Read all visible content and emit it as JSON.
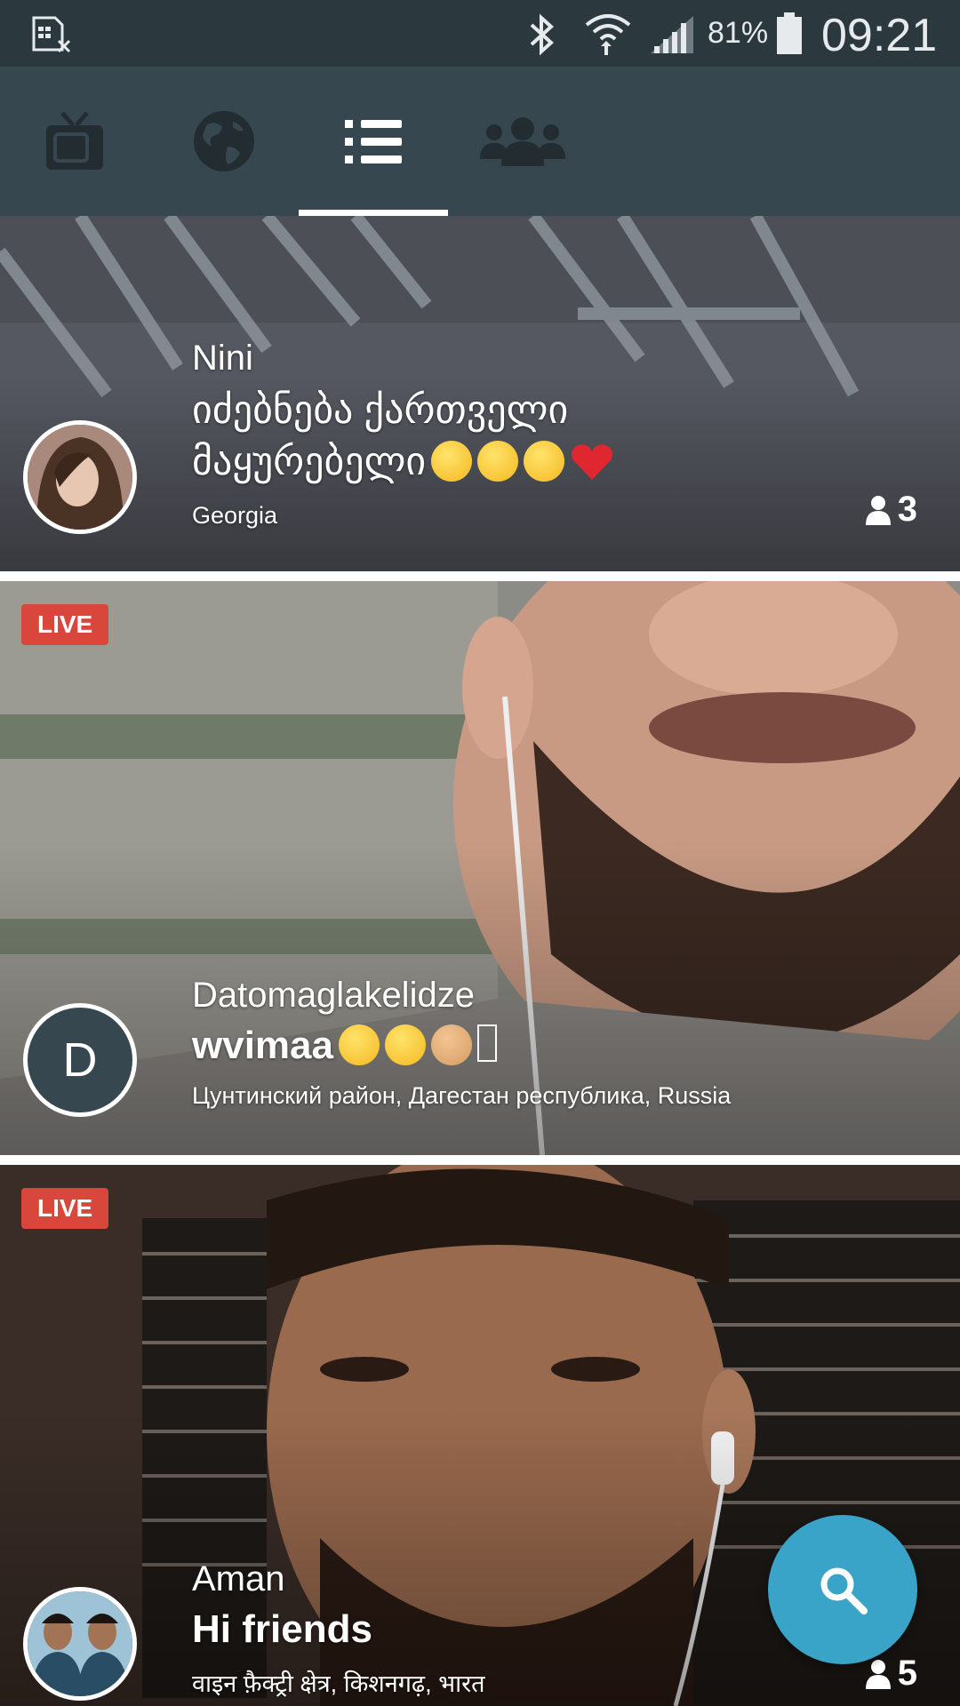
{
  "status_bar": {
    "battery_percent": "81%",
    "time": "09:21",
    "icons": [
      "sim-card-icon",
      "bluetooth-icon",
      "wifi-icon",
      "signal-icon",
      "battery-icon"
    ]
  },
  "tabs": [
    {
      "name": "tv",
      "icon": "tv-icon",
      "active": false
    },
    {
      "name": "globe",
      "icon": "globe-icon",
      "active": false
    },
    {
      "name": "list",
      "icon": "list-icon",
      "active": true
    },
    {
      "name": "people",
      "icon": "people-icon",
      "active": false
    }
  ],
  "streams": [
    {
      "username": "Nini",
      "title_line1": "იძებნება ქართველი",
      "title_line2": "მაყურებელი",
      "location": "Georgia",
      "viewers": "3",
      "live": false
    },
    {
      "username": "Datomaglakelidze",
      "avatar_letter": "D",
      "title": "wvimaa",
      "location": "Цунтинский район, Дагестан республика, Russia",
      "live": true,
      "live_label": "LIVE"
    },
    {
      "username": "Aman",
      "title": "Hi friends",
      "location": "वाइन फ़ैक्ट्री क्षेत्र, किशनगढ़, भारत",
      "viewers": "5",
      "live": true,
      "live_label": "LIVE"
    }
  ],
  "colors": {
    "status_bar": "#2b393f",
    "tab_bar": "#37474f",
    "live_badge": "#d9473c",
    "fab": "#3aa3c8"
  }
}
